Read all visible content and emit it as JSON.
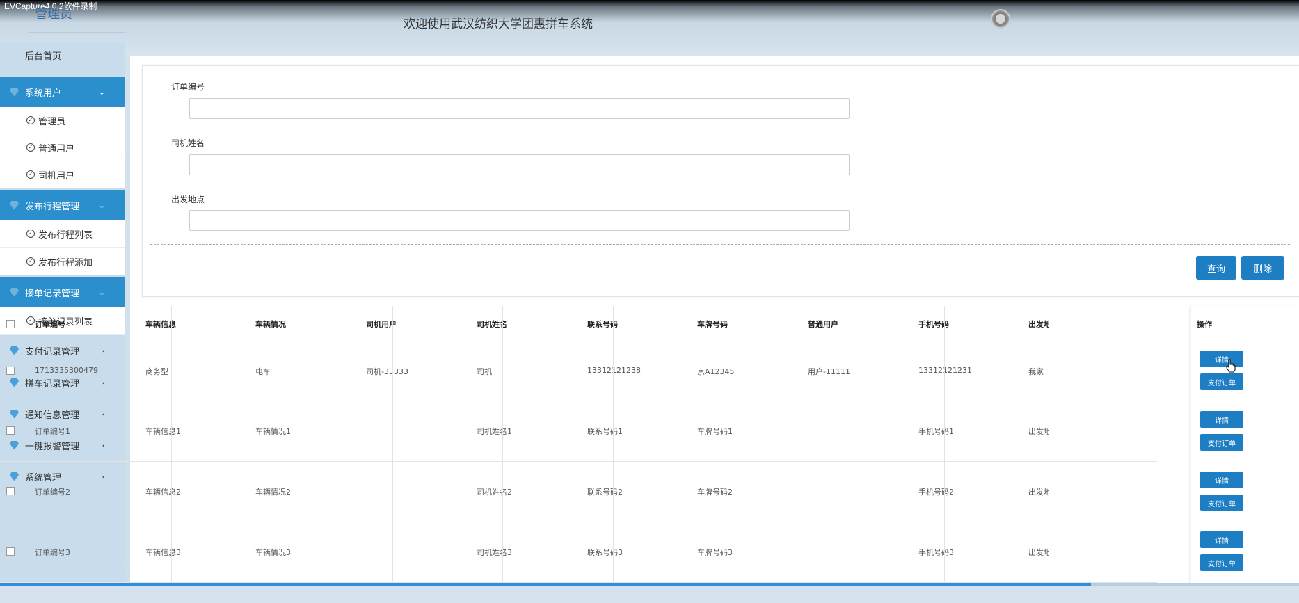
{
  "recorder_title": "EVCapture4.0.2软件录制",
  "header": {
    "role": "管理员",
    "welcome": "欢迎使用武汉纺织大学团惠拼车系统"
  },
  "sidebar": {
    "home": "后台首页",
    "groups": [
      {
        "label": "系统用户",
        "expanded": true,
        "items": [
          "管理员",
          "普通用户",
          "司机用户"
        ]
      },
      {
        "label": "发布行程管理",
        "expanded": true,
        "items": [
          "发布行程列表",
          "发布行程添加"
        ]
      },
      {
        "label": "接单记录管理",
        "expanded": true,
        "items": [
          "接单记录列表"
        ]
      },
      {
        "label": "支付记录管理",
        "expanded": false,
        "items": []
      },
      {
        "label": "拼车记录管理",
        "expanded": false,
        "items": []
      },
      {
        "label": "通知信息管理",
        "expanded": false,
        "items": []
      },
      {
        "label": "一键报警管理",
        "expanded": false,
        "items": []
      },
      {
        "label": "系统管理",
        "expanded": false,
        "items": []
      }
    ]
  },
  "search": {
    "fields": [
      {
        "label": "订单编号",
        "value": ""
      },
      {
        "label": "司机姓名",
        "value": ""
      },
      {
        "label": "出发地点",
        "value": ""
      }
    ],
    "query_button": "查询",
    "delete_button": "删除"
  },
  "table": {
    "columns": [
      "订单编号",
      "车辆信息",
      "车辆情况",
      "司机用户",
      "司机姓名",
      "联系号码",
      "车牌号码",
      "普通用户",
      "手机号码",
      "出发地",
      "操作"
    ],
    "rows": [
      [
        "1713335300479",
        "商务型",
        "电车",
        "司机-33333",
        "司机",
        "13312121238",
        "京A12345",
        "用户-11111",
        "13312121231",
        "我家"
      ],
      [
        "订单编号1",
        "车辆信息1",
        "车辆情况1",
        "",
        "司机姓名1",
        "联系号码1",
        "车牌号码1",
        "",
        "手机号码1",
        "出发地"
      ],
      [
        "订单编号2",
        "车辆信息2",
        "车辆情况2",
        "",
        "司机姓名2",
        "联系号码2",
        "车牌号码2",
        "",
        "手机号码2",
        "出发地"
      ],
      [
        "订单编号3",
        "车辆信息3",
        "车辆情况3",
        "",
        "司机姓名3",
        "联系号码3",
        "车牌号码3",
        "",
        "手机号码3",
        "出发地"
      ]
    ],
    "detail_button": "详情",
    "pay_button": "支付订单"
  },
  "playback_progress": 0.84,
  "colors": {
    "accent": "#1e7ec4",
    "sidebar_active": "#2b8fce",
    "sidebar_bg": "#c9dceb"
  }
}
